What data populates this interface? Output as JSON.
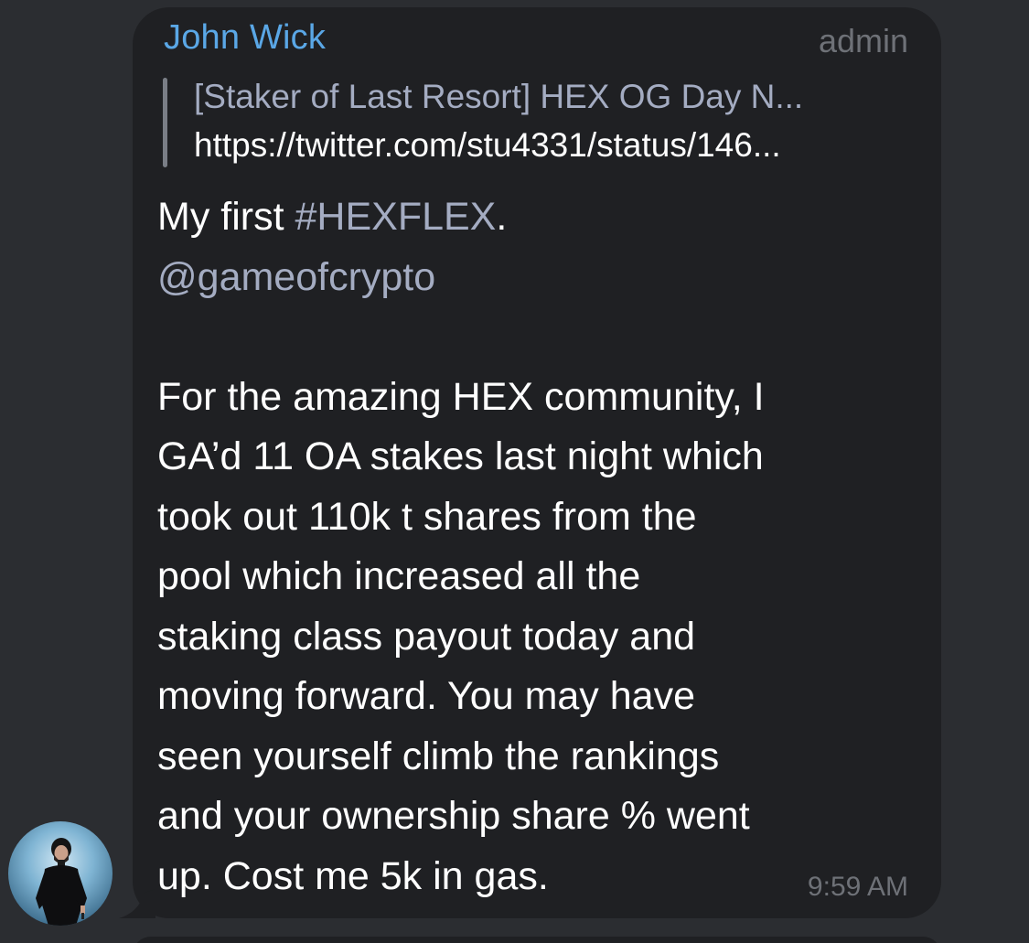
{
  "message": {
    "sender": "John Wick",
    "role": "admin",
    "reply": {
      "title": "[Staker of Last Resort] HEX OG Day N...",
      "link": "https://twitter.com/stu4331/status/146..."
    },
    "body": {
      "line1_prefix": "My first ",
      "hashtag": "#HEXFLEX",
      "line1_suffix": ".",
      "mention": "@gameofcrypto",
      "paragraph_lines": [
        "For the amazing HEX community, I",
        "GA’d 11 OA stakes last night which",
        "took out 110k t shares from the",
        "pool which increased all the",
        "staking class payout today and",
        "moving forward. You may have",
        "seen yourself climb the rankings",
        "and your ownership share % went",
        "up. Cost me 5k in gas."
      ]
    },
    "time": "9:59 AM"
  },
  "colors": {
    "background": "#2b2d31",
    "bubble": "#1f2023",
    "sender_name": "#5aa7e6",
    "link_gray": "#a4acc2",
    "meta_gray": "#6e7177"
  },
  "icons": {
    "avatar": "user-avatar-photo"
  }
}
